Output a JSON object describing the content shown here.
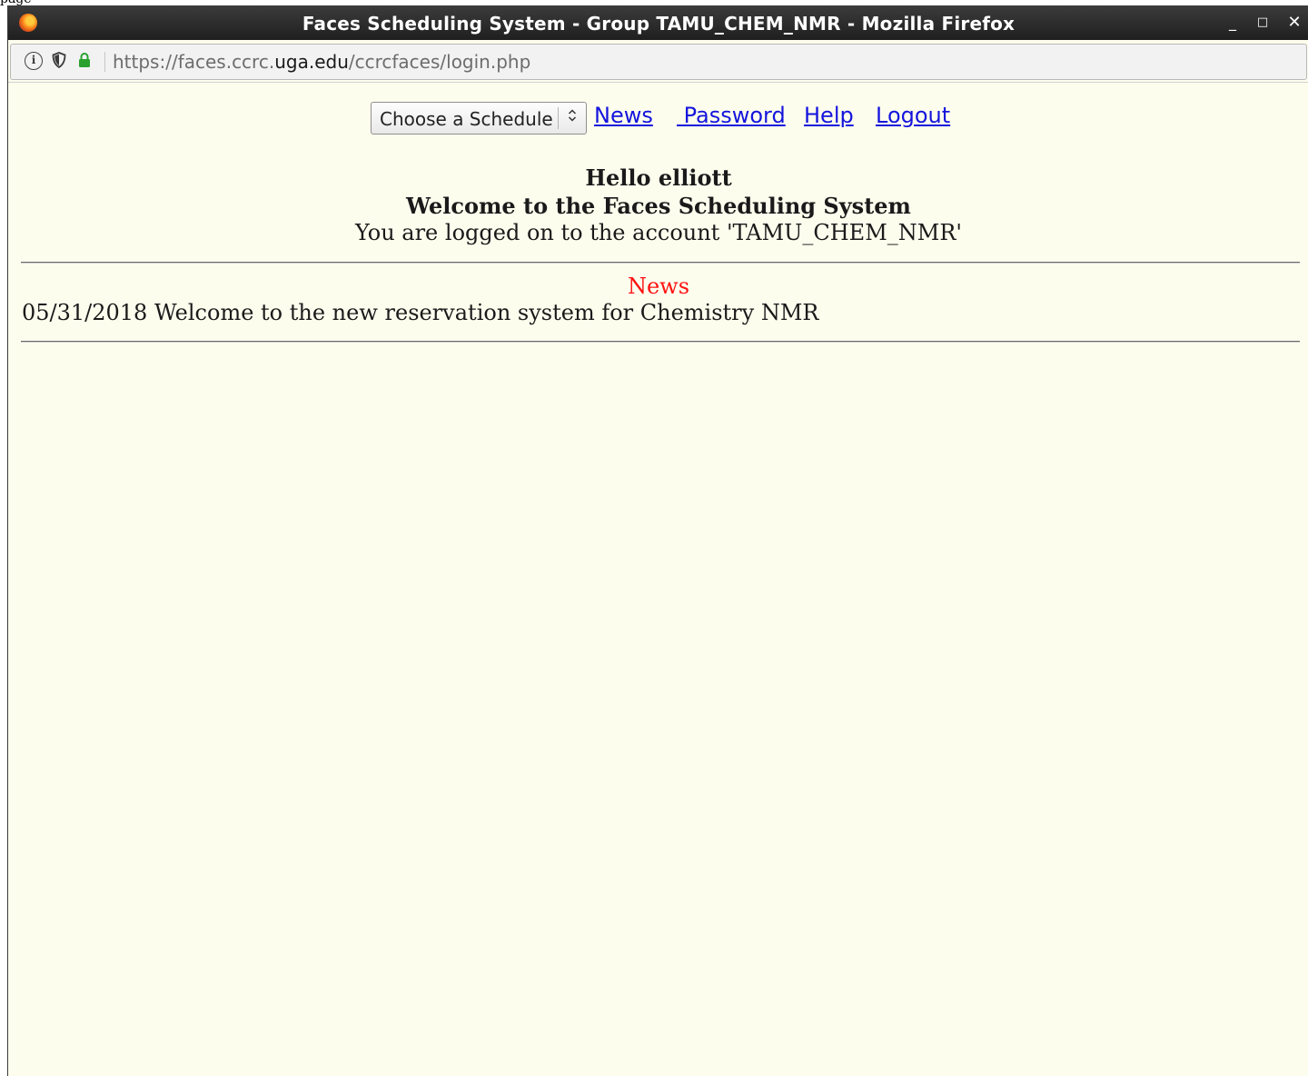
{
  "top_strip_text": "page",
  "window": {
    "title": "Faces Scheduling System - Group TAMU_CHEM_NMR - Mozilla Firefox",
    "controls": {
      "minimize": "_",
      "maximize": "□",
      "close": "✕"
    }
  },
  "urlbar": {
    "url_prefix": "https://faces.ccrc.",
    "url_domain": "uga.edu",
    "url_path": "/ccrcfaces/login.php",
    "icons": [
      "info-icon",
      "tracking-shield-icon",
      "lock-icon"
    ],
    "lock_color": "#2aa12e"
  },
  "nav": {
    "schedule_select": {
      "selected": "Choose a Schedule",
      "arrow": "⇕"
    },
    "links": {
      "news": "News",
      "password": " Password",
      "help": "Help",
      "logout": "Logout"
    },
    "link_color": "#1414dd"
  },
  "welcome": {
    "hello": "Hello elliott",
    "title": "Welcome to the Faces Scheduling System",
    "account": "You are logged on to the account 'TAMU_CHEM_NMR'"
  },
  "news": {
    "heading": "News",
    "heading_color": "#ff1111",
    "items": [
      {
        "text": "05/31/2018 Welcome to the new reservation system for Chemistry NMR"
      }
    ]
  },
  "colors": {
    "page_background": "#fdfdee",
    "titlebar": "#2a2a2a"
  }
}
